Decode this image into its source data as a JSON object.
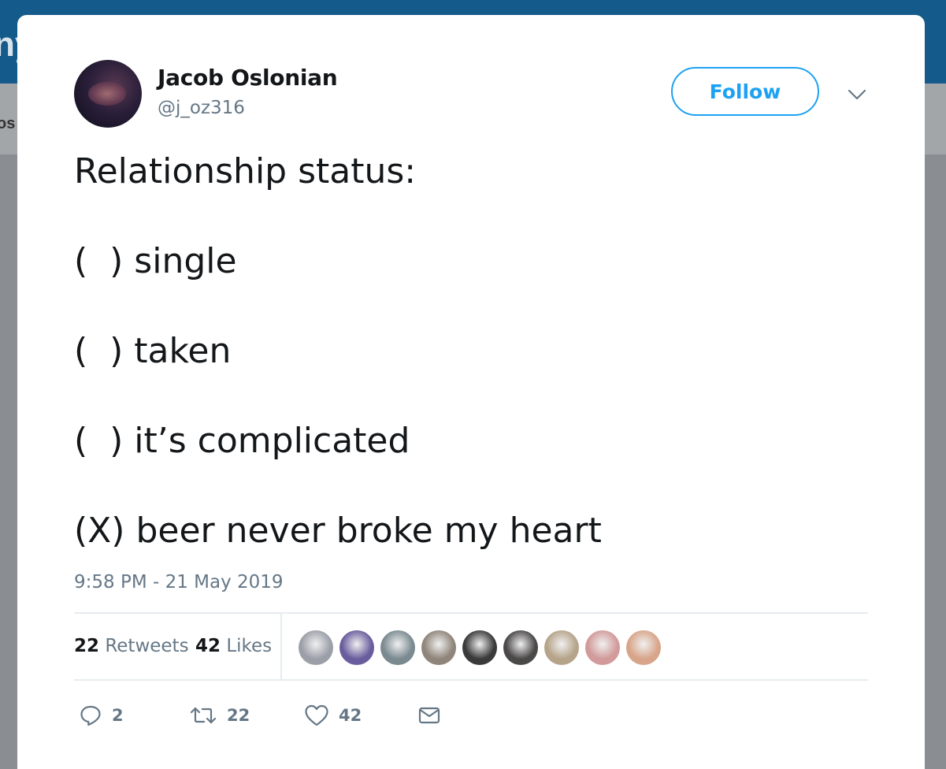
{
  "background": {
    "logo_fragment": "ny",
    "nav_fragment": "os"
  },
  "tweet": {
    "author_name": "Jacob Oslonian",
    "author_handle": "@j_oz316",
    "follow_label": "Follow",
    "lines": [
      "Relationship status:",
      "(  ) single",
      "(  ) taken",
      "(  ) it’s complicated",
      "(X) beer never broke my heart"
    ],
    "timestamp": "9:58 PM - 21 May 2019",
    "retweet_count": "22",
    "retweet_label": "Retweets",
    "like_count": "42",
    "like_label": "Likes",
    "liker_avatars": [
      {
        "icon": "user-avatar",
        "color": "#9b9fa8"
      },
      {
        "icon": "user-avatar",
        "color": "#6a5d9e"
      },
      {
        "icon": "user-avatar",
        "color": "#7a8a90"
      },
      {
        "icon": "user-avatar",
        "color": "#8f857a"
      },
      {
        "icon": "user-avatar",
        "color": "#3a3a3a"
      },
      {
        "icon": "user-avatar",
        "color": "#4b4848"
      },
      {
        "icon": "user-avatar",
        "color": "#b6a48a"
      },
      {
        "icon": "user-avatar",
        "color": "#d29a9a"
      },
      {
        "icon": "user-avatar",
        "color": "#d8a58a"
      }
    ],
    "actions": {
      "reply_count": "2",
      "retweet_count": "22",
      "like_count": "42"
    }
  },
  "colors": {
    "accent": "#1da1f2",
    "text_primary": "#14171a",
    "text_secondary": "#657786",
    "divider": "#e6ecf0",
    "topbar": "#145a8a"
  }
}
